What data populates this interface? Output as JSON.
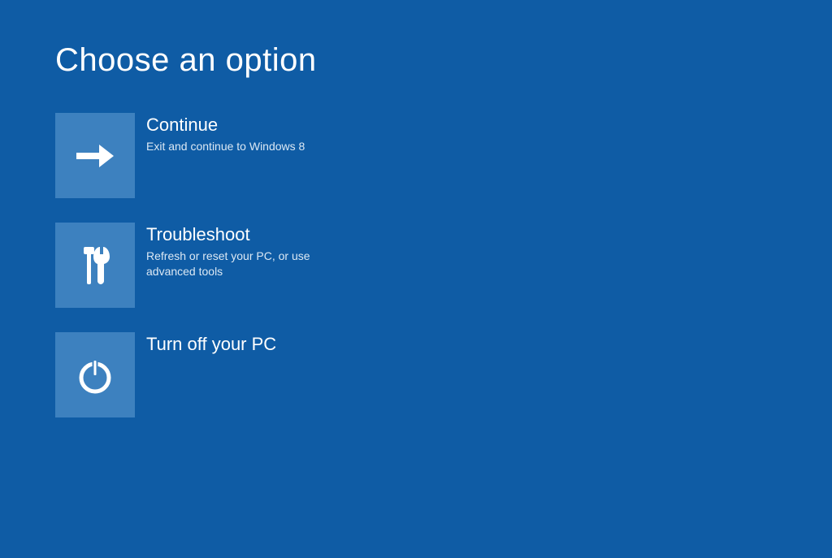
{
  "title": "Choose an option",
  "options": [
    {
      "title": "Continue",
      "description": "Exit and continue to Windows 8"
    },
    {
      "title": "Troubleshoot",
      "description": "Refresh or reset your PC, or use advanced tools"
    },
    {
      "title": "Turn off your PC",
      "description": ""
    }
  ]
}
